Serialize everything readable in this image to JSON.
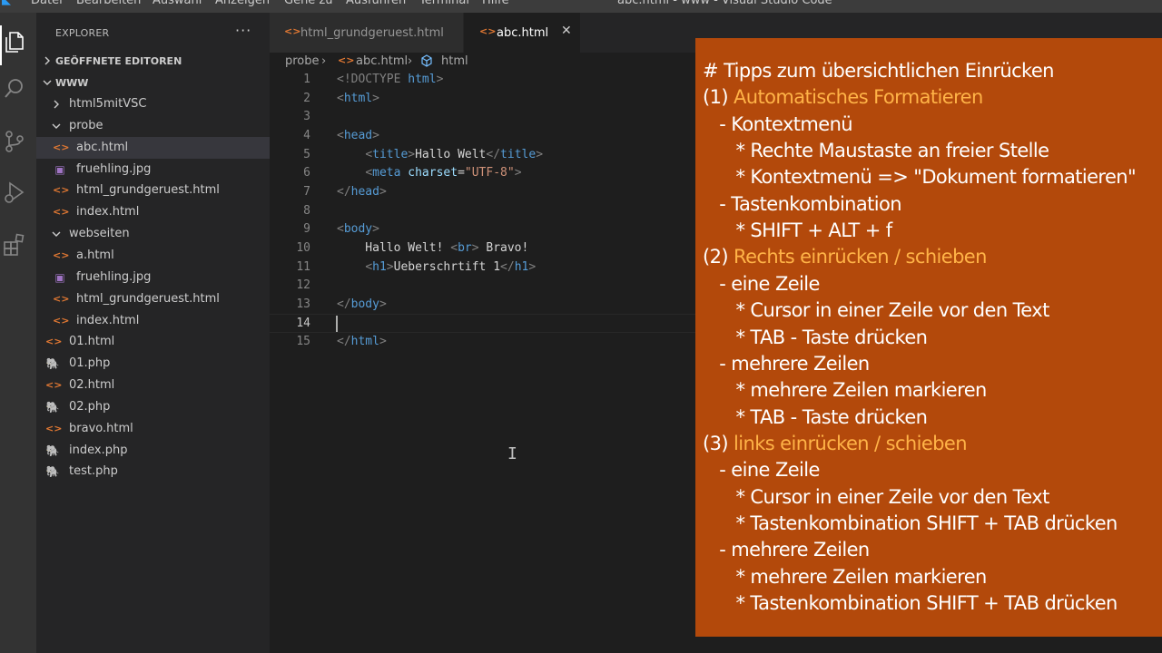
{
  "window": {
    "title": "abc.html - www - Visual Studio Code",
    "menu": [
      "Datei",
      "Bearbeiten",
      "Auswahl",
      "Anzeigen",
      "Gehe zu",
      "Ausführen",
      "Terminal",
      "Hilfe"
    ]
  },
  "activity_bar": {
    "items": [
      "explorer-icon",
      "search-icon",
      "source-control-icon",
      "run-debug-icon",
      "extensions-icon"
    ]
  },
  "sidebar": {
    "header": "EXPLORER",
    "more_actions": "···",
    "open_editors_label": "GEÖFFNETE EDITOREN",
    "workspace_label": "WWW",
    "tree": [
      {
        "name": "html5mitVSC",
        "type": "folder",
        "expanded": false,
        "depth": 1
      },
      {
        "name": "probe",
        "type": "folder",
        "expanded": true,
        "depth": 1
      },
      {
        "name": "abc.html",
        "type": "html",
        "depth": 2,
        "selected": true
      },
      {
        "name": "fruehling.jpg",
        "type": "image",
        "depth": 2
      },
      {
        "name": "html_grundgeruest.html",
        "type": "html",
        "depth": 2
      },
      {
        "name": "index.html",
        "type": "html",
        "depth": 2
      },
      {
        "name": "webseiten",
        "type": "folder",
        "expanded": true,
        "depth": 1
      },
      {
        "name": "a.html",
        "type": "html",
        "depth": 2
      },
      {
        "name": "fruehling.jpg",
        "type": "image",
        "depth": 2
      },
      {
        "name": "html_grundgeruest.html",
        "type": "html",
        "depth": 2
      },
      {
        "name": "index.html",
        "type": "html",
        "depth": 2
      },
      {
        "name": "01.html",
        "type": "html",
        "depth": 1
      },
      {
        "name": "01.php",
        "type": "php",
        "depth": 1
      },
      {
        "name": "02.html",
        "type": "html",
        "depth": 1
      },
      {
        "name": "02.php",
        "type": "php",
        "depth": 1
      },
      {
        "name": "bravo.html",
        "type": "html",
        "depth": 1
      },
      {
        "name": "index.php",
        "type": "php",
        "depth": 1
      },
      {
        "name": "test.php",
        "type": "php",
        "depth": 1
      }
    ]
  },
  "tabs": [
    {
      "label": "html_grundgeruest.html",
      "active": false,
      "icon": "html-file-icon"
    },
    {
      "label": "abc.html",
      "active": true,
      "icon": "html-file-icon",
      "close": "✕"
    }
  ],
  "breadcrumb": {
    "folder": "probe",
    "file": "abc.html",
    "symbol": "html"
  },
  "editor": {
    "current_line": 14,
    "lines": [
      {
        "n": "1",
        "tokens": [
          [
            "p",
            "<"
          ],
          [
            "p",
            "!DOCTYPE "
          ],
          [
            "t",
            "html"
          ],
          [
            "p",
            ">"
          ]
        ]
      },
      {
        "n": "2",
        "tokens": [
          [
            "p",
            "<"
          ],
          [
            "t",
            "html"
          ],
          [
            "p",
            ">"
          ]
        ]
      },
      {
        "n": "3",
        "tokens": []
      },
      {
        "n": "4",
        "tokens": [
          [
            "p",
            "<"
          ],
          [
            "t",
            "head"
          ],
          [
            "p",
            ">"
          ]
        ]
      },
      {
        "n": "5",
        "tokens": [
          [
            "x",
            "    "
          ],
          [
            "p",
            "<"
          ],
          [
            "t",
            "title"
          ],
          [
            "p",
            ">"
          ],
          [
            "x",
            "Hallo Welt"
          ],
          [
            "p",
            "</"
          ],
          [
            "t",
            "title"
          ],
          [
            "p",
            ">"
          ]
        ]
      },
      {
        "n": "6",
        "tokens": [
          [
            "x",
            "    "
          ],
          [
            "p",
            "<"
          ],
          [
            "t",
            "meta"
          ],
          [
            "x",
            " "
          ],
          [
            "a",
            "charset"
          ],
          [
            "x",
            "="
          ],
          [
            "s",
            "\"UTF-8\""
          ],
          [
            "p",
            ">"
          ]
        ]
      },
      {
        "n": "7",
        "tokens": [
          [
            "p",
            "</"
          ],
          [
            "t",
            "head"
          ],
          [
            "p",
            ">"
          ]
        ]
      },
      {
        "n": "8",
        "tokens": []
      },
      {
        "n": "9",
        "tokens": [
          [
            "p",
            "<"
          ],
          [
            "t",
            "body"
          ],
          [
            "p",
            ">"
          ]
        ]
      },
      {
        "n": "10",
        "tokens": [
          [
            "x",
            "    Hallo Welt! "
          ],
          [
            "p",
            "<"
          ],
          [
            "t",
            "br"
          ],
          [
            "p",
            ">"
          ],
          [
            "x",
            " Bravo!"
          ]
        ]
      },
      {
        "n": "11",
        "tokens": [
          [
            "x",
            "    "
          ],
          [
            "p",
            "<"
          ],
          [
            "t",
            "h1"
          ],
          [
            "p",
            ">"
          ],
          [
            "x",
            "Ueberschrtift 1"
          ],
          [
            "p",
            "</"
          ],
          [
            "t",
            "h1"
          ],
          [
            "p",
            ">"
          ]
        ]
      },
      {
        "n": "12",
        "tokens": []
      },
      {
        "n": "13",
        "tokens": [
          [
            "p",
            "</"
          ],
          [
            "t",
            "body"
          ],
          [
            "p",
            ">"
          ]
        ]
      },
      {
        "n": "14",
        "tokens": []
      },
      {
        "n": "15",
        "tokens": [
          [
            "p",
            "</"
          ],
          [
            "t",
            "html"
          ],
          [
            "p",
            ">"
          ]
        ]
      }
    ]
  },
  "notes": {
    "lines": [
      [
        {
          "text": "# Tipps zum übersichtlichen Einrücken"
        }
      ],
      [
        {
          "text": "(1) "
        },
        {
          "text": "Automatisches Formatieren",
          "accent": true
        }
      ],
      [
        {
          "text": "   - Kontextmenü"
        }
      ],
      [
        {
          "text": "      * Rechte Maustaste an freier Stelle"
        }
      ],
      [
        {
          "text": "      * Kontextmenü => \"Dokument formatieren\""
        }
      ],
      [
        {
          "text": "   - Tastenkombination"
        }
      ],
      [
        {
          "text": "      * SHIFT + ALT + f"
        }
      ],
      [
        {
          "text": "(2) "
        },
        {
          "text": "Rechts einrücken / schieben",
          "accent": true
        }
      ],
      [
        {
          "text": "   - eine Zeile"
        }
      ],
      [
        {
          "text": "      * Cursor in einer Zeile vor den Text"
        }
      ],
      [
        {
          "text": "      * TAB - Taste drücken"
        }
      ],
      [
        {
          "text": "   - mehrere Zeilen"
        }
      ],
      [
        {
          "text": "      * mehrere Zeilen markieren"
        }
      ],
      [
        {
          "text": "      * TAB - Taste drücken"
        }
      ],
      [
        {
          "text": "(3) "
        },
        {
          "text": "links einrücken / schieben",
          "accent": true
        }
      ],
      [
        {
          "text": "   - eine Zeile"
        }
      ],
      [
        {
          "text": "      * Cursor in einer Zeile vor den Text"
        }
      ],
      [
        {
          "text": "      * Tastenkombination SHIFT + TAB drücken"
        }
      ],
      [
        {
          "text": "   - mehrere Zeilen"
        }
      ],
      [
        {
          "text": "      * mehrere Zeilen markieren"
        }
      ],
      [
        {
          "text": "      * Tastenkombination SHIFT + TAB drücken"
        }
      ]
    ]
  },
  "colors": {
    "note_background": "#b3490b",
    "note_accent": "#ffb347",
    "html_icon": "#e37933",
    "php_icon": "#a074c4",
    "tag": "#569cd6",
    "attribute": "#9cdcfe",
    "string": "#ce9178"
  }
}
